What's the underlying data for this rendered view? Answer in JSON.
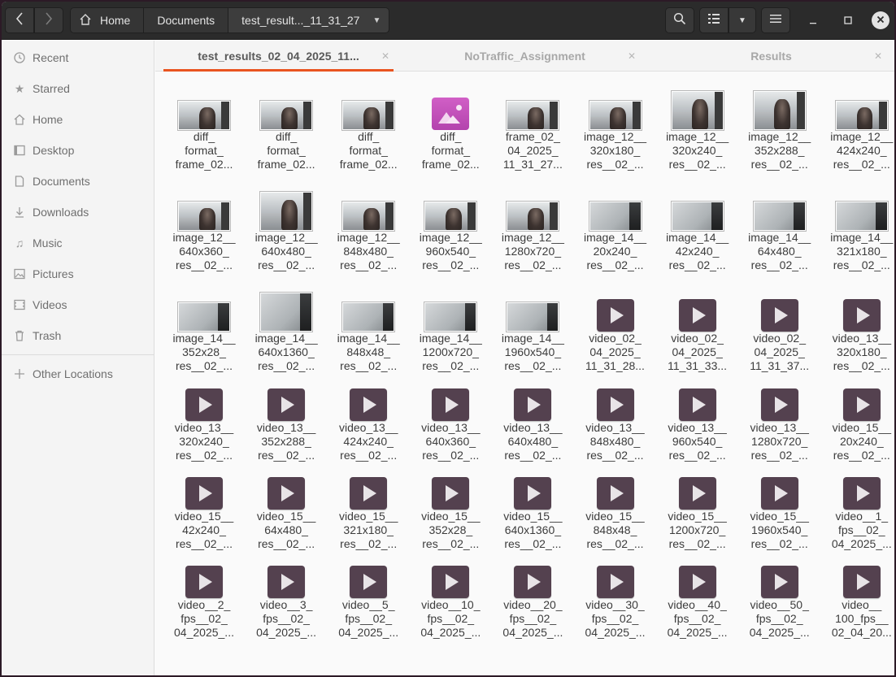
{
  "header": {
    "path": [
      {
        "label": "Home",
        "name": "breadcrumb-home"
      },
      {
        "label": "Documents",
        "name": "breadcrumb-documents"
      },
      {
        "label": "test_result..._11_31_27",
        "name": "breadcrumb-current"
      }
    ],
    "icons": {
      "back": "chevron-left-icon",
      "forward": "chevron-right-icon",
      "home": "home-icon",
      "search": "search-icon",
      "view": "list-view-icon",
      "menu": "hamburger-menu-icon"
    }
  },
  "sidebar": {
    "items": [
      {
        "label": "Recent",
        "icon": "clock-icon",
        "name": "sidebar-item-recent"
      },
      {
        "label": "Starred",
        "icon": "star-icon",
        "name": "sidebar-item-starred"
      },
      {
        "label": "Home",
        "icon": "home-icon",
        "name": "sidebar-item-home"
      },
      {
        "label": "Desktop",
        "icon": "desktop-icon",
        "name": "sidebar-item-desktop"
      },
      {
        "label": "Documents",
        "icon": "documents-icon",
        "name": "sidebar-item-documents"
      },
      {
        "label": "Downloads",
        "icon": "download-icon",
        "name": "sidebar-item-downloads"
      },
      {
        "label": "Music",
        "icon": "music-icon",
        "name": "sidebar-item-music"
      },
      {
        "label": "Pictures",
        "icon": "pictures-icon",
        "name": "sidebar-item-pictures"
      },
      {
        "label": "Videos",
        "icon": "video-icon",
        "name": "sidebar-item-videos"
      },
      {
        "label": "Trash",
        "icon": "trash-icon",
        "name": "sidebar-item-trash"
      }
    ],
    "other_locations": {
      "label": "Other Locations",
      "icon": "plus-icon"
    }
  },
  "tabs": [
    {
      "label": "test_results_02_04_2025_11...",
      "active": true
    },
    {
      "label": "NoTraffic_Assignment",
      "active": false
    },
    {
      "label": "Results",
      "active": false
    }
  ],
  "accent_color": "#e95420",
  "files": [
    {
      "type": "photo",
      "lines": [
        "diff_",
        "format_",
        "frame_02..."
      ]
    },
    {
      "type": "photo",
      "lines": [
        "diff_",
        "format_",
        "frame_02..."
      ]
    },
    {
      "type": "photo",
      "lines": [
        "diff_",
        "format_",
        "frame_02..."
      ]
    },
    {
      "type": "image-icon",
      "lines": [
        "diff_",
        "format_",
        "frame_02..."
      ]
    },
    {
      "type": "photo",
      "lines": [
        "frame_02_",
        "04_2025_",
        "11_31_27..."
      ]
    },
    {
      "type": "photo",
      "lines": [
        "image_12__",
        "320x180_",
        "res__02_..."
      ]
    },
    {
      "type": "photo-tall",
      "lines": [
        "image_12__",
        "320x240_",
        "res__02_..."
      ]
    },
    {
      "type": "photo-tall",
      "lines": [
        "image_12__",
        "352x288_",
        "res__02_..."
      ]
    },
    {
      "type": "photo",
      "lines": [
        "image_12__",
        "424x240_",
        "res__02_..."
      ]
    },
    {
      "type": "photo",
      "lines": [
        "image_12__",
        "640x360_",
        "res__02_..."
      ]
    },
    {
      "type": "photo-tall",
      "lines": [
        "image_12__",
        "640x480_",
        "res__02_..."
      ]
    },
    {
      "type": "photo",
      "lines": [
        "image_12__",
        "848x480_",
        "res__02_..."
      ]
    },
    {
      "type": "photo",
      "lines": [
        "image_12__",
        "960x540_",
        "res__02_..."
      ]
    },
    {
      "type": "photo",
      "lines": [
        "image_12__",
        "1280x720_",
        "res__02_..."
      ]
    },
    {
      "type": "wall",
      "lines": [
        "image_14__",
        "20x240_",
        "res__02_..."
      ]
    },
    {
      "type": "wall",
      "lines": [
        "image_14__",
        "42x240_",
        "res__02_..."
      ]
    },
    {
      "type": "wall",
      "lines": [
        "image_14__",
        "64x480_",
        "res__02_..."
      ]
    },
    {
      "type": "wall",
      "lines": [
        "image_14__",
        "321x180_",
        "res__02_..."
      ]
    },
    {
      "type": "wall",
      "lines": [
        "image_14__",
        "352x28_",
        "res__02_..."
      ]
    },
    {
      "type": "wall-tall",
      "lines": [
        "image_14__",
        "640x1360_",
        "res__02_..."
      ]
    },
    {
      "type": "wall",
      "lines": [
        "image_14__",
        "848x48_",
        "res__02_..."
      ]
    },
    {
      "type": "wall",
      "lines": [
        "image_14__",
        "1200x720_",
        "res__02_..."
      ]
    },
    {
      "type": "wall",
      "lines": [
        "image_14__",
        "1960x540_",
        "res__02_..."
      ]
    },
    {
      "type": "video",
      "lines": [
        "video_02_",
        "04_2025_",
        "11_31_28..."
      ]
    },
    {
      "type": "video",
      "lines": [
        "video_02_",
        "04_2025_",
        "11_31_33..."
      ]
    },
    {
      "type": "video",
      "lines": [
        "video_02_",
        "04_2025_",
        "11_31_37..."
      ]
    },
    {
      "type": "video",
      "lines": [
        "video_13__",
        "320x180_",
        "res__02_..."
      ]
    },
    {
      "type": "video",
      "lines": [
        "video_13__",
        "320x240_",
        "res__02_..."
      ]
    },
    {
      "type": "video",
      "lines": [
        "video_13__",
        "352x288_",
        "res__02_..."
      ]
    },
    {
      "type": "video",
      "lines": [
        "video_13__",
        "424x240_",
        "res__02_..."
      ]
    },
    {
      "type": "video",
      "lines": [
        "video_13__",
        "640x360_",
        "res__02_..."
      ]
    },
    {
      "type": "video",
      "lines": [
        "video_13__",
        "640x480_",
        "res__02_..."
      ]
    },
    {
      "type": "video",
      "lines": [
        "video_13__",
        "848x480_",
        "res__02_..."
      ]
    },
    {
      "type": "video",
      "lines": [
        "video_13__",
        "960x540_",
        "res__02_..."
      ]
    },
    {
      "type": "video",
      "lines": [
        "video_13__",
        "1280x720_",
        "res__02_..."
      ]
    },
    {
      "type": "video",
      "lines": [
        "video_15__",
        "20x240_",
        "res__02_..."
      ]
    },
    {
      "type": "video",
      "lines": [
        "video_15__",
        "42x240_",
        "res__02_..."
      ]
    },
    {
      "type": "video",
      "lines": [
        "video_15__",
        "64x480_",
        "res__02_..."
      ]
    },
    {
      "type": "video",
      "lines": [
        "video_15__",
        "321x180_",
        "res__02_..."
      ]
    },
    {
      "type": "video",
      "lines": [
        "video_15__",
        "352x28_",
        "res__02_..."
      ]
    },
    {
      "type": "video",
      "lines": [
        "video_15__",
        "640x1360_",
        "res__02_..."
      ]
    },
    {
      "type": "video",
      "lines": [
        "video_15__",
        "848x48_",
        "res__02_..."
      ]
    },
    {
      "type": "video",
      "lines": [
        "video_15__",
        "1200x720_",
        "res__02_..."
      ]
    },
    {
      "type": "video",
      "lines": [
        "video_15__",
        "1960x540_",
        "res__02_..."
      ]
    },
    {
      "type": "video",
      "lines": [
        "video__1_",
        "fps__02_",
        "04_2025_..."
      ]
    },
    {
      "type": "video",
      "lines": [
        "video__2_",
        "fps__02_",
        "04_2025_..."
      ]
    },
    {
      "type": "video",
      "lines": [
        "video__3_",
        "fps__02_",
        "04_2025_..."
      ]
    },
    {
      "type": "video",
      "lines": [
        "video__5_",
        "fps__02_",
        "04_2025_..."
      ]
    },
    {
      "type": "video",
      "lines": [
        "video__10_",
        "fps__02_",
        "04_2025_..."
      ]
    },
    {
      "type": "video",
      "lines": [
        "video__20_",
        "fps__02_",
        "04_2025_..."
      ]
    },
    {
      "type": "video",
      "lines": [
        "video__30_",
        "fps__02_",
        "04_2025_..."
      ]
    },
    {
      "type": "video",
      "lines": [
        "video__40_",
        "fps__02_",
        "04_2025_..."
      ]
    },
    {
      "type": "video",
      "lines": [
        "video__50_",
        "fps__02_",
        "04_2025_..."
      ]
    },
    {
      "type": "video",
      "lines": [
        "video__",
        "100_fps__",
        "02_04_20..."
      ]
    }
  ]
}
